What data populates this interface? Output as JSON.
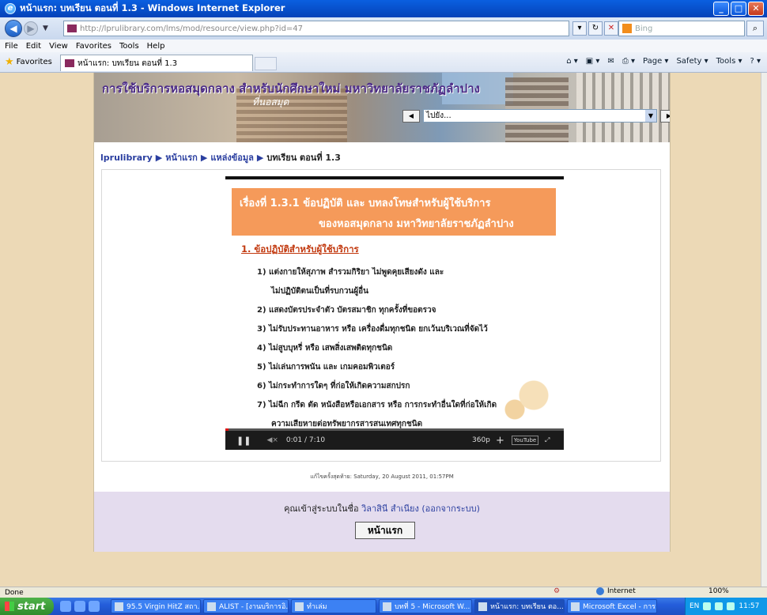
{
  "window": {
    "title": "หน้าแรก: บทเรียน ตอนที่ 1.3 - Windows Internet Explorer",
    "buttons": {
      "minimize": "_",
      "maximize": "□",
      "close": "✕"
    }
  },
  "address_bar": {
    "url": "http://lprulibrary.com/lms/mod/resource/view.php?id=47",
    "search_placeholder": "Bing"
  },
  "menu": [
    "File",
    "Edit",
    "View",
    "Favorites",
    "Tools",
    "Help"
  ],
  "favorites_bar": {
    "favorites_label": "Favorites",
    "tab_title": "หน้าแรก: บทเรียน ตอนที่ 1.3",
    "commands": [
      "Page ▾",
      "Safety ▾",
      "Tools ▾"
    ]
  },
  "page": {
    "banner_title": "การใช้บริการหอสมุดกลาง สำหรับนักศึกษาใหม่ มหาวิทยาลัยราชภัฏลำปาง",
    "banner_text": "ที่นอสมุด",
    "jump_select": "ไปยัง...",
    "breadcrumb": {
      "items": [
        "lprulibrary",
        "หน้าแรก",
        "แหล่งข้อมูล"
      ],
      "current": "บทเรียน ตอนที่ 1.3"
    },
    "slide": {
      "title_line1": "เรื่องที่ 1.3.1  ข้อปฏิบัติ และ บทลงโทษสำหรับผู้ใช้บริการ",
      "title_line2": "ของหอสมุดกลาง มหาวิทยาลัยราชภัฏลำปาง",
      "subtitle": "1. ข้อปฏิบัติสำหรับผู้ใช้บริการ",
      "items": [
        "1)  แต่งกายให้สุภาพ สำรวมกิริยา ไม่พูดคุยเสียงดัง และ",
        "ไม่ปฏิบัติตนเป็นที่รบกวนผู้อื่น",
        "2)  แสดงบัตรประจำตัว บัตรสมาชิก ทุกครั้งที่ขอตรวจ",
        "3)  ไม่รับประทานอาหาร หรือ เครื่องดื่มทุกชนิด ยกเว้นบริเวณที่จัดไว้",
        "4)  ไม่สูบบุหรี่ หรือ เสพสิ่งเสพติดทุกชนิด",
        "5)  ไม่เล่นการพนัน และ เกมคอมพิวเตอร์",
        "6)  ไม่กระทำการใดๆ ที่ก่อให้เกิดความสกปรก",
        "7)  ไม่ฉีก กรีด ตัด หนังสือหรือเอกสาร หรือ การกระทำอื่นใดที่ก่อให้เกิด",
        "ความเสียหายต่อทรัพยากรสารสนเทศทุกชนิด"
      ]
    },
    "player": {
      "time": "0:01 / 7:10",
      "quality": "360p",
      "progress_percent": 0.2,
      "youtube_label": "YouTube"
    },
    "last_modified": "แก้ไขครั้งสุดท้าย: Saturday, 20 August 2011, 01:57PM",
    "login": {
      "prefix": "คุณเข้าสู่ระบบในชื่อ ",
      "user": "วิลาสินี สำเนียง",
      "logout": "(ออกจากระบบ)"
    },
    "home_button": "หน้าแรก"
  },
  "status_bar": {
    "status": "Done",
    "zone": "Internet",
    "zoom": "100%"
  },
  "taskbar": {
    "start": "start",
    "tasks": [
      "95.5 Virgin HitZ สถา...",
      "ALIST - [งานบริการอิ...",
      "ทำเล่ม",
      "บทที่ 5 - Microsoft W...",
      "หน้าแรก: บทเรียน ตอ...",
      "Microsoft Excel - การ..."
    ],
    "lang": "EN",
    "clock": "11:57"
  }
}
